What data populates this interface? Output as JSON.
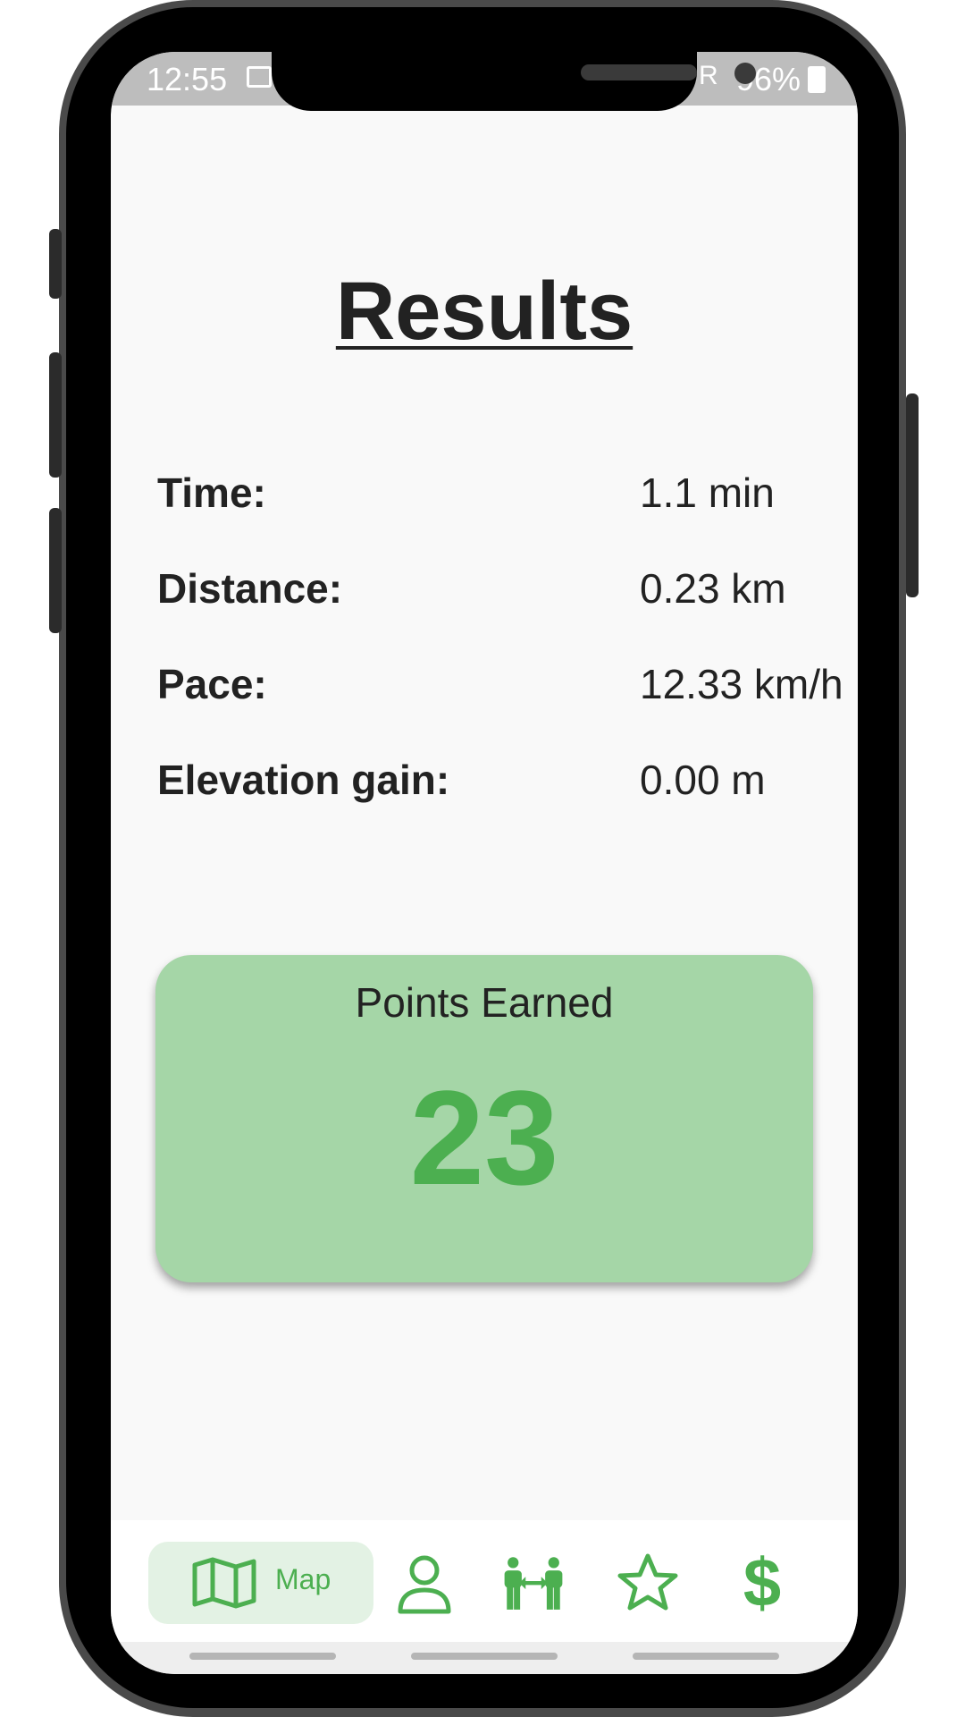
{
  "status_bar": {
    "time": "12:55",
    "signal_label": "R",
    "battery": "96%"
  },
  "page": {
    "title": "Results"
  },
  "stats": [
    {
      "label": "Time:",
      "value": "1.1 min"
    },
    {
      "label": "Distance:",
      "value": "0.23 km"
    },
    {
      "label": "Pace:",
      "value": "12.33 km/h"
    },
    {
      "label": "Elevation gain:",
      "value": "0.00 m"
    }
  ],
  "points": {
    "label": "Points Earned",
    "value": "23"
  },
  "nav": {
    "active_label": "Map",
    "items": [
      {
        "icon": "map-icon",
        "label": "Map",
        "active": true
      },
      {
        "icon": "person-icon"
      },
      {
        "icon": "friends-transfer-icon"
      },
      {
        "icon": "star-icon"
      },
      {
        "icon": "dollar-icon"
      }
    ]
  },
  "colors": {
    "accent": "#4caf50",
    "card": "#a5d6a7",
    "active_nav": "#e3f2e4",
    "text": "#222222"
  }
}
